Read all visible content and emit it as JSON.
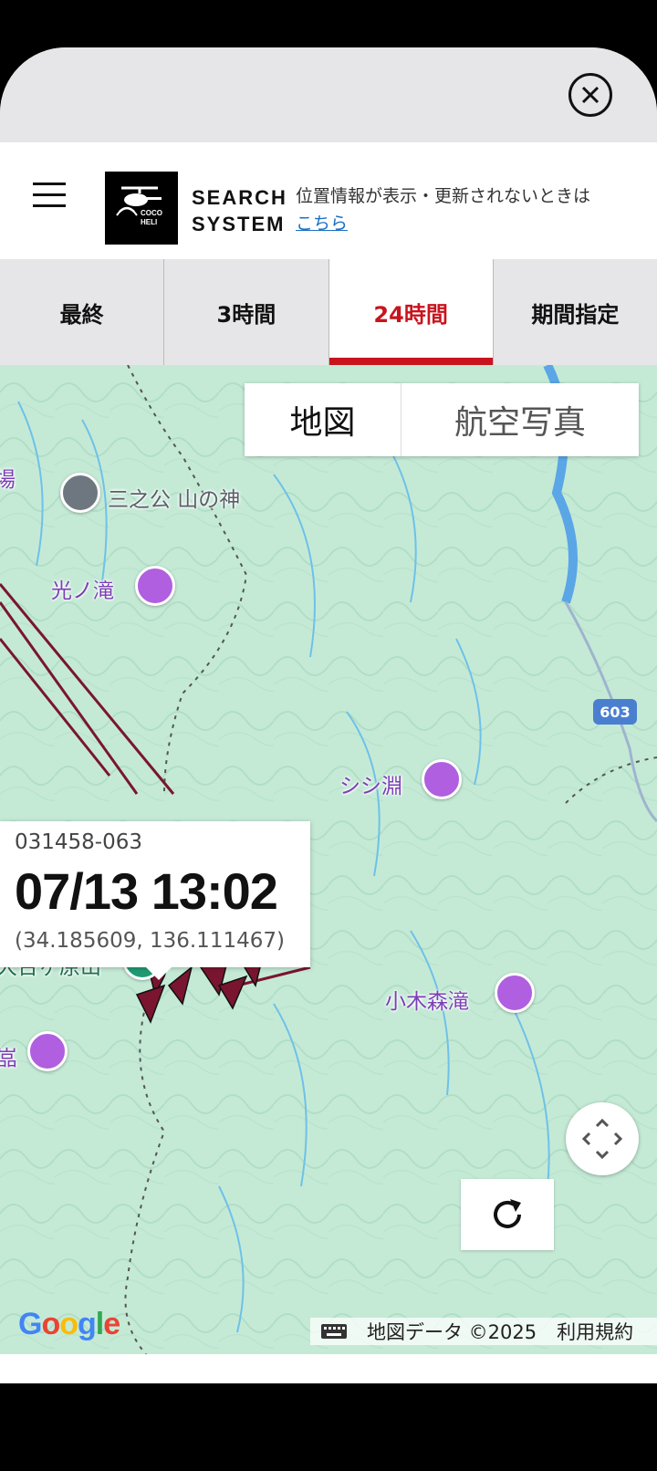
{
  "header": {
    "logo_icon": "helicopter-icon",
    "logo_small_text": "COCO HELI",
    "brand_line1": "SEARCH",
    "brand_line2": "SYSTEM",
    "hint_text": "位置情報が表示・更新されないときは",
    "hint_link": "こちら"
  },
  "tabs": [
    {
      "label": "最終",
      "active": false
    },
    {
      "label": "3時間",
      "active": false
    },
    {
      "label": "24時間",
      "active": true
    },
    {
      "label": "期間指定",
      "active": false
    }
  ],
  "map_type": {
    "map": "地図",
    "satellite": "航空写真",
    "selected": "map"
  },
  "pois": [
    {
      "label": "三之公 山の神",
      "icon": "shrine-icon"
    },
    {
      "label": "光ノ滝",
      "icon": "poi-icon"
    },
    {
      "label": "シシ淵",
      "icon": "poi-icon"
    },
    {
      "label": "大台ヶ原山",
      "icon": "mountain-icon"
    },
    {
      "label": "小木森滝",
      "icon": "poi-icon"
    },
    {
      "label": "嵓",
      "icon": "poi-icon"
    },
    {
      "label": "場",
      "icon": "text"
    },
    {
      "label": "603",
      "icon": "road-badge"
    }
  ],
  "info_window": {
    "id": "031458-063",
    "datetime": "07/13 13:02",
    "coords": "(34.185609, 136.111467)"
  },
  "attribution": {
    "google": "Google",
    "map_data": "地図データ ©2025",
    "terms": "利用規約"
  },
  "colors": {
    "accent": "#c8141e",
    "track": "#7a1530",
    "map_bg": "#c4ead6",
    "link": "#1a6fc4"
  }
}
